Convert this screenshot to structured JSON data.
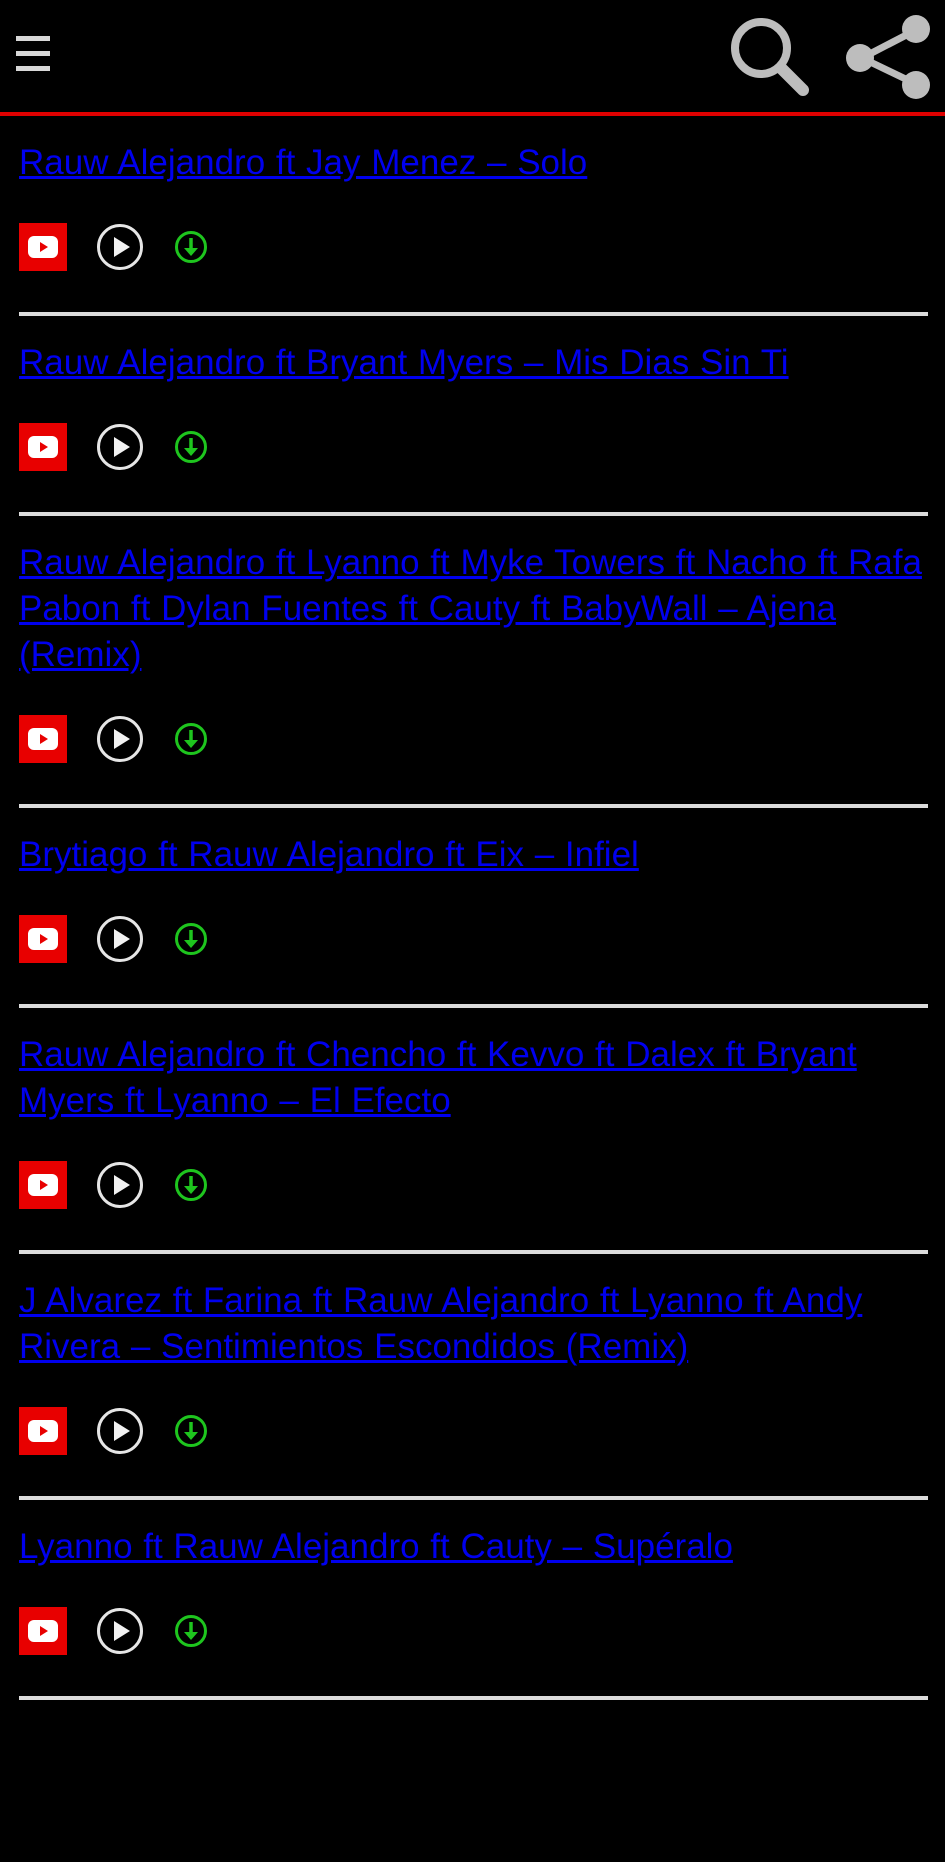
{
  "header": {
    "menu_icon": "hamburger-menu-icon",
    "search_icon": "search-icon",
    "share_icon": "share-icon",
    "accent_color": "#e00000"
  },
  "songs": [
    {
      "title": "Rauw Alejandro ft Jay Menez – Solo"
    },
    {
      "title": "Rauw Alejandro ft Bryant Myers – Mis Dias Sin Ti"
    },
    {
      "title": "Rauw Alejandro ft Lyanno ft Myke Towers ft Nacho ft Rafa Pabon ft Dylan Fuentes ft Cauty ft BabyWall – Ajena (Remix)"
    },
    {
      "title": "Brytiago ft Rauw Alejandro ft Eix – Infiel"
    },
    {
      "title": "Rauw Alejandro ft Chencho ft Kevvo ft Dalex ft Bryant Myers ft Lyanno – El Efecto"
    },
    {
      "title": "J Alvarez ft Farina ft Rauw Alejandro ft Lyanno ft Andy Rivera – Sentimientos Escondidos (Remix)"
    },
    {
      "title": "Lyanno ft Rauw Alejandro ft Cauty – Supéralo"
    }
  ],
  "colors": {
    "link": "#0000ee",
    "youtube": "#e80000",
    "download": "#1ec51e",
    "divider": "#dcdcdc"
  }
}
